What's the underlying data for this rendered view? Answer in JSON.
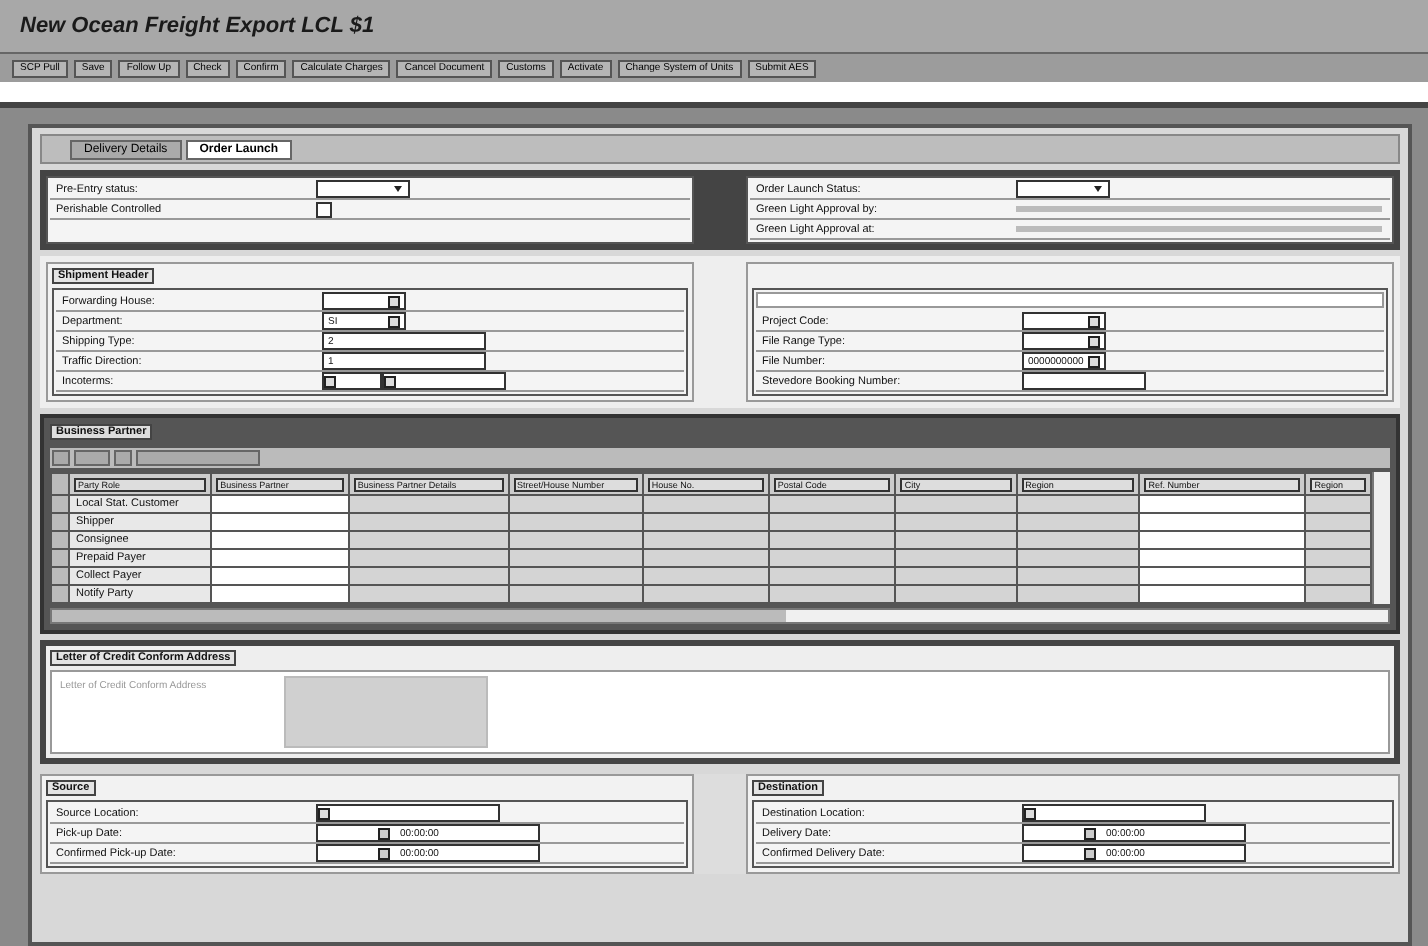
{
  "window": {
    "title": "New Ocean Freight Export LCL $1"
  },
  "toolbar": [
    "SCP Pull",
    "Save",
    "Follow Up",
    "Check",
    "Confirm",
    "Calculate Charges",
    "Cancel Document",
    "Customs",
    "Activate",
    "Change System of Units",
    "Submit AES"
  ],
  "tabs": [
    {
      "label": "Delivery Details",
      "selected": false
    },
    {
      "label": "Order Launch",
      "selected": true
    }
  ],
  "status_left": [
    {
      "label": "Pre-Entry status:",
      "kind": "dropdown"
    },
    {
      "label": "Perishable Controlled",
      "kind": "checkbox",
      "checked": false
    }
  ],
  "status_right": [
    {
      "label": "Order Launch Status:",
      "kind": "dropdown"
    },
    {
      "label": "Green Light Approval by:",
      "kind": "line"
    },
    {
      "label": "Green Light Approval at:",
      "kind": "line"
    }
  ],
  "shipment_header": {
    "title": "Shipment Header",
    "left": [
      {
        "label": "Forwarding House:",
        "kind": "lookup"
      },
      {
        "label": "Department:",
        "kind": "lookup",
        "value": "SI"
      },
      {
        "label": "Shipping Type:",
        "kind": "text",
        "value": "2"
      },
      {
        "label": "Traffic Direction:",
        "kind": "text",
        "value": "1"
      },
      {
        "label": "Incoterms:",
        "kind": "double"
      }
    ],
    "right": [
      {
        "label": "Project Code:",
        "kind": "lookup"
      },
      {
        "label": "File Range Type:",
        "kind": "lookup"
      },
      {
        "label": "File Number:",
        "kind": "lookup",
        "value": "0000000000"
      },
      {
        "label": "Stevedore Booking Number:",
        "kind": "text"
      }
    ]
  },
  "business_partner": {
    "title": "Business Partner",
    "columns": [
      "Party Role",
      "Business Partner",
      "Business Partner Details",
      "Street/House Number",
      "House No.",
      "Postal Code",
      "City",
      "Region",
      "Ref. Number",
      "Region"
    ],
    "rows": [
      "Local Stat. Customer",
      "Shipper",
      "Consignee",
      "Prepaid Payer",
      "Collect Payer",
      "Notify Party"
    ]
  },
  "letter_of_credit": {
    "title": "Letter of Credit Conform Address",
    "placeholder": "Letter of Credit Conform Address"
  },
  "source": {
    "title": "Source",
    "fields": [
      {
        "label": "Source Location:",
        "kind": "lookup"
      },
      {
        "label": "Pick-up Date:",
        "kind": "date",
        "value": "00:00:00"
      },
      {
        "label": "Confirmed Pick-up Date:",
        "kind": "date",
        "value": "00:00:00"
      }
    ]
  },
  "destination": {
    "title": "Destination",
    "fields": [
      {
        "label": "Destination Location:",
        "kind": "lookup"
      },
      {
        "label": "Delivery Date:",
        "kind": "date",
        "value": "00:00:00"
      },
      {
        "label": "Confirmed Delivery Date:",
        "kind": "date",
        "value": "00:00:00"
      }
    ]
  }
}
